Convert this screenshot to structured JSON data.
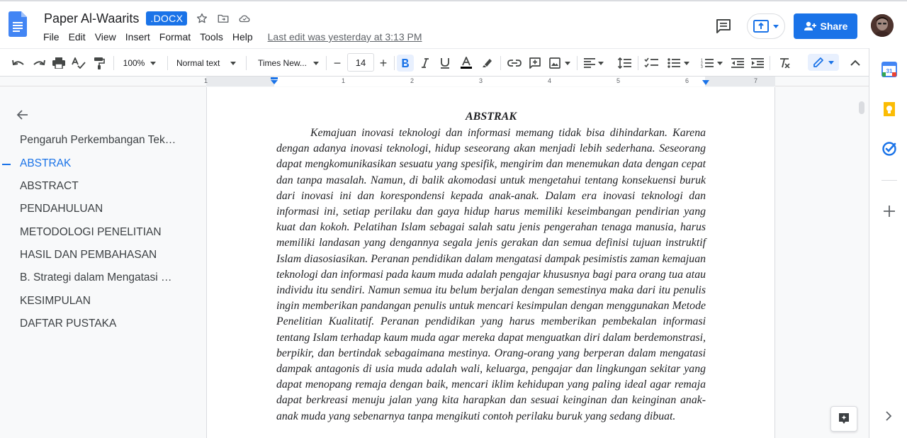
{
  "header": {
    "doc_title": "Paper Al-Waarits",
    "format_badge": ".DOCX",
    "menu": [
      "File",
      "Edit",
      "View",
      "Insert",
      "Format",
      "Tools",
      "Help"
    ],
    "last_edit": "Last edit was yesterday at 3:13 PM",
    "share_label": "Share"
  },
  "toolbar": {
    "zoom": "100%",
    "style": "Normal text",
    "font": "Times New...",
    "font_size": "14",
    "minus": "−",
    "plus": "+"
  },
  "ruler": {
    "numbers": [
      "1",
      "1",
      "2",
      "3",
      "4",
      "5",
      "6",
      "7"
    ]
  },
  "outline": {
    "items": [
      {
        "label": "Pengaruh Perkembangan Tek…",
        "active": false
      },
      {
        "label": "ABSTRAK",
        "active": true
      },
      {
        "label": "ABSTRACT",
        "active": false
      },
      {
        "label": "PENDAHULUAN",
        "active": false
      },
      {
        "label": "METODOLOGI PENELITIAN",
        "active": false
      },
      {
        "label": "HASIL DAN PEMBAHASAN",
        "active": false
      },
      {
        "label": "B. Strategi dalam  Mengatasi …",
        "active": false
      },
      {
        "label": "KESIMPULAN",
        "active": false
      },
      {
        "label": "DAFTAR PUSTAKA",
        "active": false
      }
    ]
  },
  "document": {
    "heading": "ABSTRAK",
    "body": "Kemajuan inovasi teknologi dan informasi memang tidak bisa dihindarkan. Karena dengan adanya inovasi teknologi, hidup seseorang akan menjadi lebih sederhana. Seseorang dapat mengkomunikasikan sesuatu yang spesifik, mengirim dan menemukan data dengan cepat dan tanpa masalah. Namun, di balik akomodasi untuk mengetahui tentang konsekuensi buruk dari inovasi ini dan korespondensi kepada anak-anak. Dalam era inovasi teknologi dan informasi ini, setiap perilaku dan gaya hidup harus memiliki keseimbangan pendirian yang kuat dan kokoh. Pelatihan Islam sebagai salah satu jenis pengerahan tenaga manusia, harus memiliki landasan yang dengannya segala jenis gerakan dan semua definisi tujuan instruktif Islam diasosiasikan. Peranan pendidikan dalam mengatasi dampak pesimistis zaman kemajuan teknologi dan informasi pada kaum muda adalah pengajar khususnya bagi para orang tua atau individu itu sendiri. Namun semua itu belum berjalan dengan semestinya maka dari itu penulis ingin memberikan pandangan penulis untuk mencari kesimpulan dengan menggunakan Metode Penelitian Kualitatif. Peranan pendidikan yang harus memberikan pembekalan informasi tentang Islam terhadap kaum muda agar mereka dapat menguatkan diri dalam berdemonstrasi, berpikir, dan bertindak sebagaimana mestinya. Orang-orang yang berperan dalam mengatasi dampak antagonis di usia muda adalah wali, keluarga, pengajar dan lingkungan sekitar yang dapat menopang remaja dengan baik, mencari iklim kehidupan yang paling ideal agar remaja dapat berkreasi menuju jalan yang kita harapkan dan sesuai keinginan dan keinginan anak-anak muda yang sebenarnya tanpa mengikuti contoh perilaku buruk yang sedang dibuat."
  },
  "colors": {
    "accent": "#1a73e8",
    "text": "#202124",
    "muted": "#5f6368"
  }
}
